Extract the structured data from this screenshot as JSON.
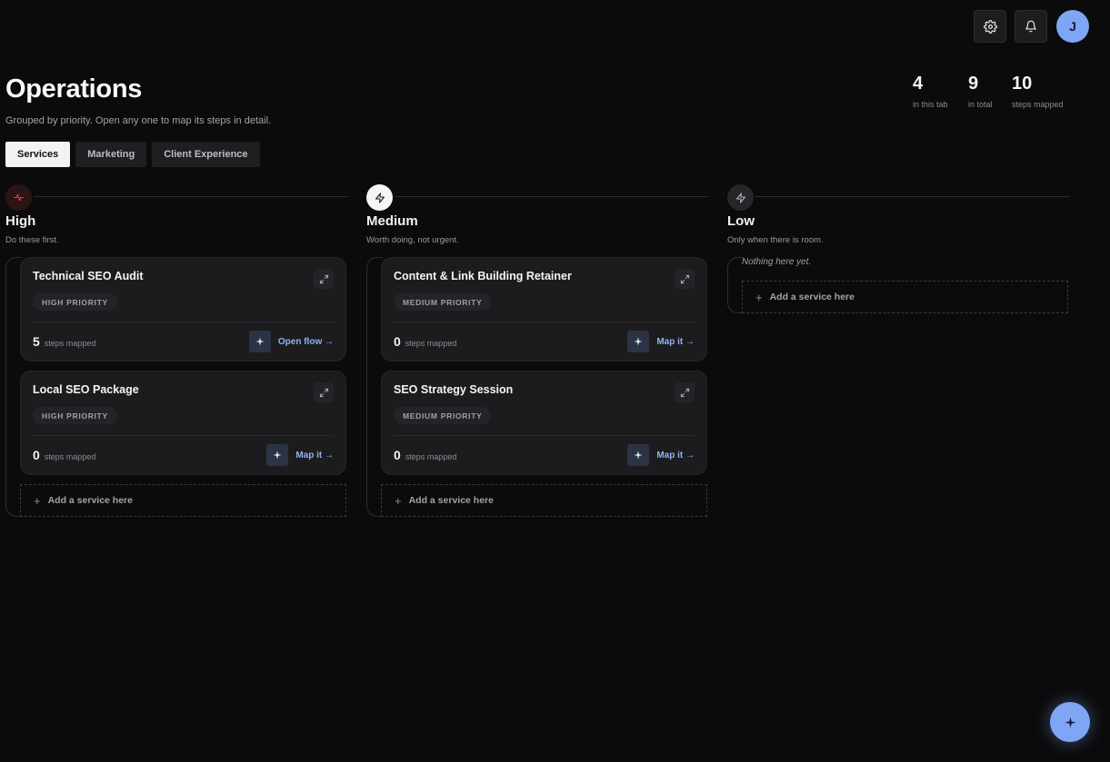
{
  "header": {
    "title": "Operations",
    "subtitle": "Grouped by priority. Open any one to map its steps in detail.",
    "avatar_initial": "J",
    "settings_icon": "gear-icon",
    "notifications_icon": "bell-icon"
  },
  "stats": [
    {
      "value": "4",
      "label": "in this tab"
    },
    {
      "value": "9",
      "label": "in total"
    },
    {
      "value": "10",
      "label": "steps mapped"
    }
  ],
  "tabs": [
    {
      "label": "Services",
      "active": true
    },
    {
      "label": "Marketing",
      "active": false
    },
    {
      "label": "Client Experience",
      "active": false
    }
  ],
  "columns": [
    {
      "title": "High",
      "desc": "Do these first.",
      "icon": "pulse-icon",
      "accent": "#e5484d",
      "cards": [
        {
          "title": "Technical SEO Audit",
          "badge": "HIGH PRIORITY",
          "steps": "5",
          "steps_label": "steps mapped",
          "action": "Open flow →"
        },
        {
          "title": "Local SEO Package",
          "badge": "HIGH PRIORITY",
          "steps": "0",
          "steps_label": "steps mapped",
          "action": "Map it →"
        }
      ],
      "add_label": "Add a service here"
    },
    {
      "title": "Medium",
      "desc": "Worth doing, not urgent.",
      "icon": "bolt-icon",
      "accent": "#ffffff",
      "cards": [
        {
          "title": "Content & Link Building Retainer",
          "badge": "MEDIUM PRIORITY",
          "steps": "0",
          "steps_label": "steps mapped",
          "action": "Map it →"
        },
        {
          "title": "SEO Strategy Session",
          "badge": "MEDIUM PRIORITY",
          "steps": "0",
          "steps_label": "steps mapped",
          "action": "Map it →"
        }
      ],
      "add_label": "Add a service here"
    },
    {
      "title": "Low",
      "desc": "Only when there is room.",
      "icon": "bolt-icon",
      "accent": "#2a2a2e",
      "empty_text": "Nothing here yet.",
      "add_label": "Add a service here"
    }
  ],
  "colors": {
    "background": "#0b0b0c",
    "card": "#1c1c1f",
    "accent_blue": "#7fa6f4",
    "link_blue": "#8fb2f3"
  }
}
